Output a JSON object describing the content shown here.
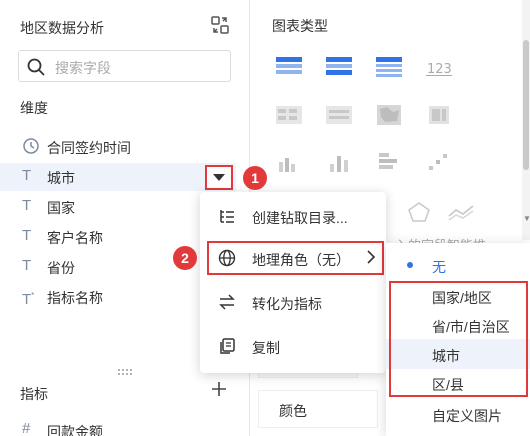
{
  "left_panel": {
    "title": "地区数据分析",
    "search_placeholder": "搜索字段",
    "dimension_label": "维度",
    "dimensions": [
      {
        "label": "合同签约时间",
        "icon": "clock-icon"
      },
      {
        "label": "城市",
        "icon": "text-type-icon"
      },
      {
        "label": "国家",
        "icon": "text-type-icon"
      },
      {
        "label": "客户名称",
        "icon": "text-type-icon"
      },
      {
        "label": "省份",
        "icon": "text-type-icon"
      },
      {
        "label": "指标名称",
        "icon": "text-type-star-icon"
      }
    ],
    "metric_label": "指标",
    "metrics": [
      {
        "label": "回款金额",
        "icon": "hash-icon"
      }
    ]
  },
  "right_panel": {
    "chart_type_label": "图表类型",
    "hint_text": "入的字段智能推",
    "color_label": "颜色"
  },
  "context_menu": {
    "items": [
      {
        "label": "创建钻取目录...",
        "icon": "drill-tree-icon"
      },
      {
        "label": "地理角色（无）",
        "icon": "globe-icon",
        "has_submenu": true
      },
      {
        "label": "转化为指标",
        "icon": "convert-arrows-icon"
      },
      {
        "label": "复制",
        "icon": "copy-icon"
      }
    ]
  },
  "submenu": {
    "items": [
      {
        "label": "无",
        "selected": true
      },
      {
        "label": "国家/地区"
      },
      {
        "label": "省/市/自治区"
      },
      {
        "label": "城市",
        "hover": true
      },
      {
        "label": "区/县"
      },
      {
        "label": "自定义图片"
      }
    ]
  },
  "markers": [
    "1",
    "2"
  ],
  "colors": {
    "accent": "#2f73e6",
    "highlight_red": "#e23a3a",
    "icon_gray": "#7d8aa0"
  }
}
